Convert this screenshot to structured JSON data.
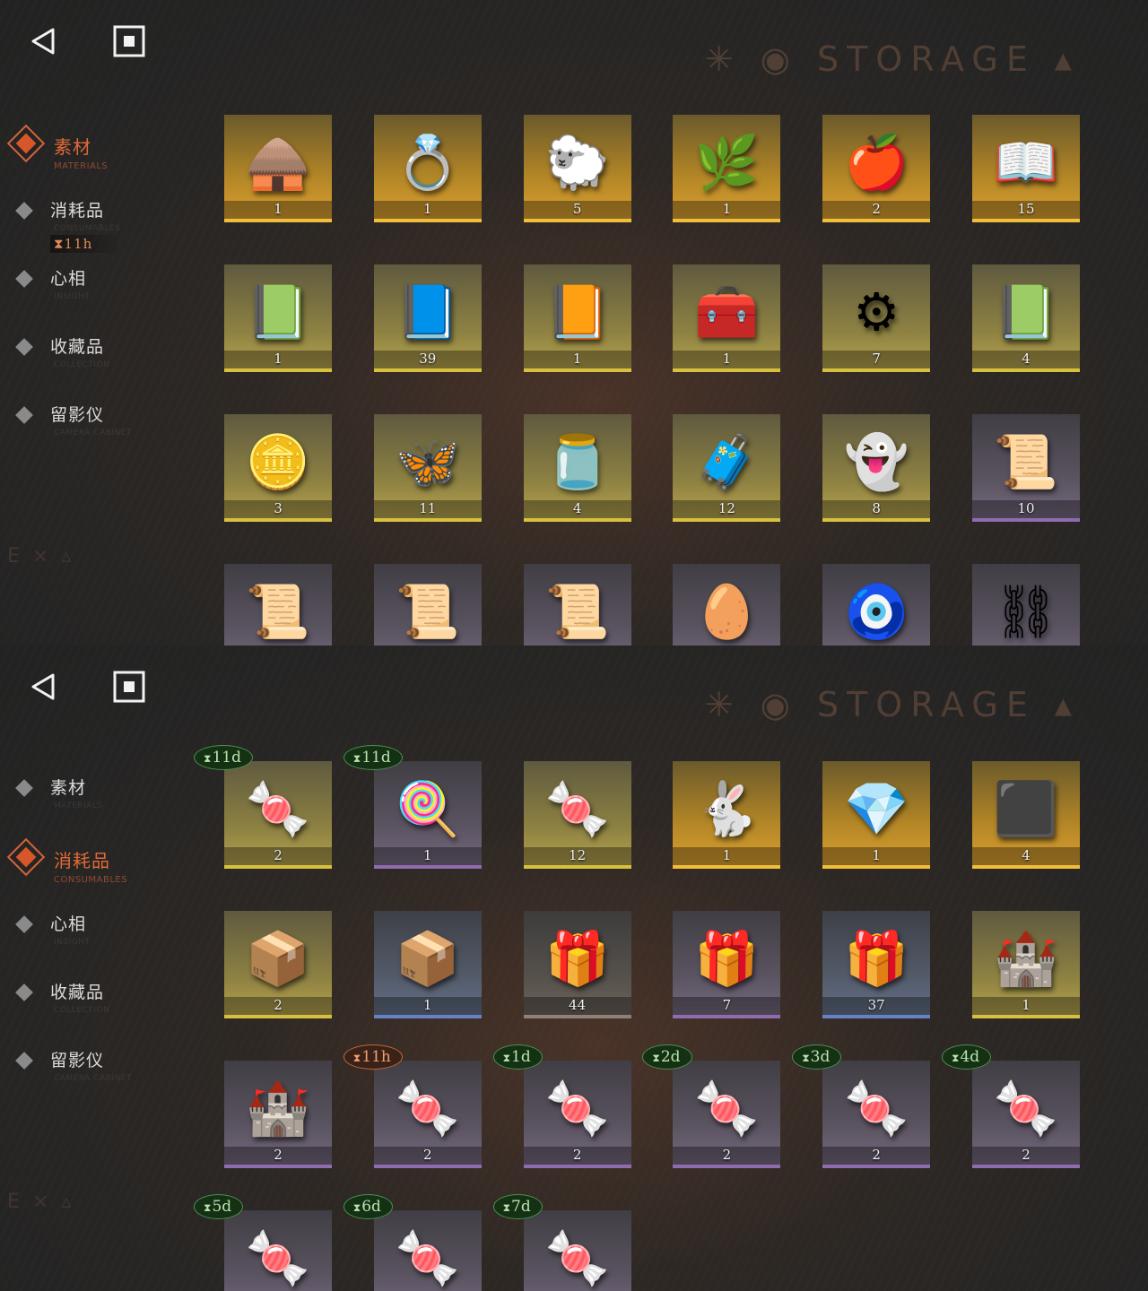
{
  "screens": [
    {
      "nav": [
        {
          "label": "素材",
          "sub": "MATERIALS",
          "active": true
        },
        {
          "label": "消耗品",
          "sub": "CONSUMABLES",
          "badge": "11h"
        },
        {
          "label": "心相",
          "sub": "INSIGHT"
        },
        {
          "label": "收藏品",
          "sub": "COLLECTION"
        },
        {
          "label": "留影仪",
          "sub": "CAMERA CABINET"
        }
      ],
      "items": [
        {
          "name": "chicken-leg-hut",
          "icon": "🛖",
          "count": "1",
          "rarity": "gold"
        },
        {
          "name": "golden-bracelet",
          "icon": "💍",
          "count": "1",
          "rarity": "gold"
        },
        {
          "name": "golden-sheep",
          "icon": "🐑",
          "count": "5",
          "rarity": "gold"
        },
        {
          "name": "laurel-wreath",
          "icon": "🌿",
          "count": "1",
          "rarity": "gold"
        },
        {
          "name": "apple-serpent",
          "icon": "🍎",
          "count": "2",
          "rarity": "gold"
        },
        {
          "name": "red-seal-book",
          "icon": "📖",
          "count": "15",
          "rarity": "gold"
        },
        {
          "name": "green-seal-book",
          "icon": "📗",
          "count": "1",
          "rarity": "yellow"
        },
        {
          "name": "blue-seal-book",
          "icon": "📘",
          "count": "39",
          "rarity": "yellow"
        },
        {
          "name": "gold-seal-book",
          "icon": "📙",
          "count": "1",
          "rarity": "yellow"
        },
        {
          "name": "overgrown-chest",
          "icon": "🧰",
          "count": "1",
          "rarity": "yellow"
        },
        {
          "name": "astrolabe",
          "icon": "⚙",
          "count": "7",
          "rarity": "yellow"
        },
        {
          "name": "green-tablet",
          "icon": "📗",
          "count": "4",
          "rarity": "yellow"
        },
        {
          "name": "puzzle-sphere",
          "icon": "🪙",
          "count": "3",
          "rarity": "yellow"
        },
        {
          "name": "glowing-moth",
          "icon": "🦋",
          "count": "11",
          "rarity": "yellow"
        },
        {
          "name": "bell-jar",
          "icon": "🫙",
          "count": "4",
          "rarity": "yellow"
        },
        {
          "name": "hand-box",
          "icon": "🧳",
          "count": "12",
          "rarity": "yellow"
        },
        {
          "name": "ghost",
          "icon": "👻",
          "count": "8",
          "rarity": "yellow"
        },
        {
          "name": "red-seal-scroll",
          "icon": "📜",
          "count": "10",
          "rarity": "purple"
        },
        {
          "name": "green-seal-scroll",
          "icon": "📜",
          "count": "",
          "rarity": "purple"
        },
        {
          "name": "blue-seal-scroll",
          "icon": "📜",
          "count": "",
          "rarity": "purple"
        },
        {
          "name": "gold-seal-scroll",
          "icon": "📜",
          "count": "",
          "rarity": "purple"
        },
        {
          "name": "heart-egg",
          "icon": "🥚",
          "count": "",
          "rarity": "purple"
        },
        {
          "name": "pendant",
          "icon": "🧿",
          "count": "",
          "rarity": "purple"
        },
        {
          "name": "chain-trinket",
          "icon": "⛓",
          "count": "",
          "rarity": "purple"
        }
      ]
    },
    {
      "nav": [
        {
          "label": "素材",
          "sub": "MATERIALS"
        },
        {
          "label": "消耗品",
          "sub": "CONSUMABLES",
          "active": true
        },
        {
          "label": "心相",
          "sub": "INSIGHT"
        },
        {
          "label": "收藏品",
          "sub": "COLLECTION"
        },
        {
          "label": "留影仪",
          "sub": "CAMERA CABINET"
        }
      ],
      "items": [
        {
          "name": "candy-jar",
          "icon": "🍬",
          "count": "2",
          "rarity": "yellow",
          "timer": "11d",
          "timer_color": "green"
        },
        {
          "name": "lollipops",
          "icon": "🍭",
          "count": "1",
          "rarity": "purple",
          "timer": "11d",
          "timer_color": "green"
        },
        {
          "name": "candy-jar",
          "icon": "🍬",
          "count": "12",
          "rarity": "yellow"
        },
        {
          "name": "rabbit-box",
          "icon": "🐇",
          "count": "1",
          "rarity": "gold"
        },
        {
          "name": "crystal",
          "icon": "💎",
          "count": "1",
          "rarity": "gold"
        },
        {
          "name": "rune-box",
          "icon": "⬛",
          "count": "4",
          "rarity": "gold"
        },
        {
          "name": "wooden-crate",
          "icon": "📦",
          "count": "2",
          "rarity": "yellow"
        },
        {
          "name": "wooden-crate",
          "icon": "📦",
          "count": "1",
          "rarity": "blue"
        },
        {
          "name": "parcel",
          "icon": "🎁",
          "count": "44",
          "rarity": "plain"
        },
        {
          "name": "parcel",
          "icon": "🎁",
          "count": "7",
          "rarity": "purple"
        },
        {
          "name": "parcel",
          "icon": "🎁",
          "count": "37",
          "rarity": "blue"
        },
        {
          "name": "sand-castle",
          "icon": "🏰",
          "count": "1",
          "rarity": "yellow"
        },
        {
          "name": "sand-castle",
          "icon": "🏰",
          "count": "2",
          "rarity": "purple"
        },
        {
          "name": "candies",
          "icon": "🍬",
          "count": "2",
          "rarity": "purple",
          "timer": "11h",
          "timer_color": "orange"
        },
        {
          "name": "candies",
          "icon": "🍬",
          "count": "2",
          "rarity": "purple",
          "timer": "1d",
          "timer_color": "green"
        },
        {
          "name": "candies",
          "icon": "🍬",
          "count": "2",
          "rarity": "purple",
          "timer": "2d",
          "timer_color": "green"
        },
        {
          "name": "candies",
          "icon": "🍬",
          "count": "2",
          "rarity": "purple",
          "timer": "3d",
          "timer_color": "green"
        },
        {
          "name": "candies",
          "icon": "🍬",
          "count": "2",
          "rarity": "purple",
          "timer": "4d",
          "timer_color": "green"
        },
        {
          "name": "candies",
          "icon": "🍬",
          "count": "",
          "rarity": "purple",
          "timer": "5d",
          "timer_color": "green"
        },
        {
          "name": "candies",
          "icon": "🍬",
          "count": "",
          "rarity": "purple",
          "timer": "6d",
          "timer_color": "green"
        },
        {
          "name": "candies",
          "icon": "🍬",
          "count": "",
          "rarity": "purple",
          "timer": "7d",
          "timer_color": "green"
        }
      ]
    }
  ],
  "header_decor": "STORAGE",
  "timer_glyph": "⧗"
}
